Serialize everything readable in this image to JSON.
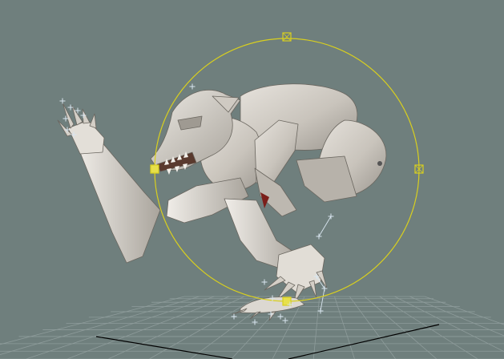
{
  "viewport": {
    "background_color": "#6f7f7d",
    "grid_line_color": "#8e9c9b",
    "grid_axis_color": "#000000",
    "model_light_color": "#dedad4",
    "model_mid_color": "#b9b4ac",
    "model_shadow_color": "#8d8881",
    "model_outline_color": "#6a665f",
    "gizmo_color": "#d8cf1f",
    "handle_fill_color": "#e7e04a",
    "bone_marker_color": "#d9e6f0",
    "mouth_color": "#5a3a2e",
    "tongue_color": "#7b1f1a"
  },
  "gizmo": {
    "name": "rotate-gizmo",
    "handles": [
      "top-handle",
      "left-handle",
      "right-handle",
      "bottom-handle"
    ]
  },
  "icons": {
    "gizmo": "circle-gizmo-icon",
    "handle": "square-handle-icon",
    "bone_marker": "plus-marker-icon"
  }
}
